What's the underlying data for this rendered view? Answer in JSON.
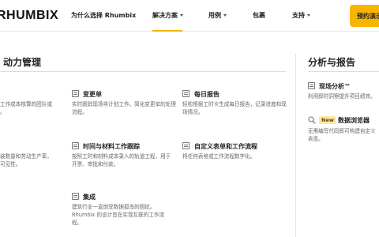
{
  "header": {
    "logo": "RHUMBIX",
    "nav": [
      {
        "label": "为什么选择 Rhumbix"
      },
      {
        "label": "解决方案"
      },
      {
        "label": "用例"
      },
      {
        "label": "包裹"
      },
      {
        "label": "支持"
      }
    ],
    "cta_label": "预约演示"
  },
  "left": {
    "title": "动力管理",
    "frag1": {
      "line1": "工作成本核算的团队或",
      "line2": "。"
    },
    "frag2": {
      "line1": "装数量和劳动生产率，",
      "line2": "可见性。"
    },
    "col1": [
      {
        "title": "变更单",
        "desc": "实时跟踪现场非计划工作。简化变更单的处理流程。"
      },
      {
        "title": "时间与材料工作跟踪",
        "desc": "按照工时和材料成本录入的轨道工程，用于开票、审批和付款。"
      },
      {
        "title": "集成",
        "desc": "建筑行业一直饱受数据孤岛的困扰。Rhumbix 的设计旨在实现互联的工作流程。"
      }
    ],
    "col2": [
      {
        "title": "每日报告",
        "desc": "轻松根据工时卡生成每日报告，记录进度和现场情况。"
      },
      {
        "title": "自定义表单和工作流程",
        "desc": "将任何表格或工作流程数字化。"
      }
    ]
  },
  "right": {
    "title": "分析与报告",
    "items": [
      {
        "title": "现场分析™",
        "desc": "利用即时洞察提升项目绩效。"
      },
      {
        "badge": "New",
        "title": "数据浏览器",
        "desc": "无需编写代码即可构建自定义表盘。"
      }
    ]
  }
}
